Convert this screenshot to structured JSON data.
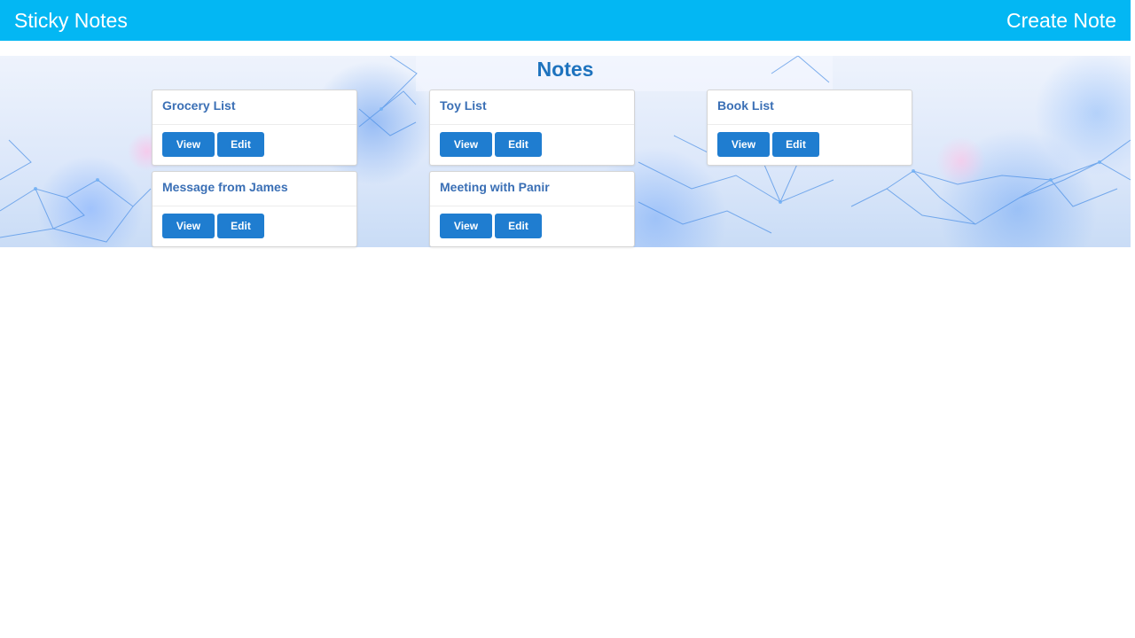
{
  "header": {
    "brand": "Sticky Notes",
    "create_note": "Create Note"
  },
  "main": {
    "title": "Notes",
    "notes": [
      {
        "title": "Grocery List",
        "view_label": "View",
        "edit_label": "Edit"
      },
      {
        "title": "Toy List",
        "view_label": "View",
        "edit_label": "Edit"
      },
      {
        "title": "Book List",
        "view_label": "View",
        "edit_label": "Edit"
      },
      {
        "title": "Message from James",
        "view_label": "View",
        "edit_label": "Edit"
      },
      {
        "title": "Meeting with Panir",
        "view_label": "View",
        "edit_label": "Edit"
      }
    ]
  },
  "colors": {
    "header_background": "#03b7f3",
    "accent": "#1f7dd0",
    "title_text": "#1e73be"
  }
}
